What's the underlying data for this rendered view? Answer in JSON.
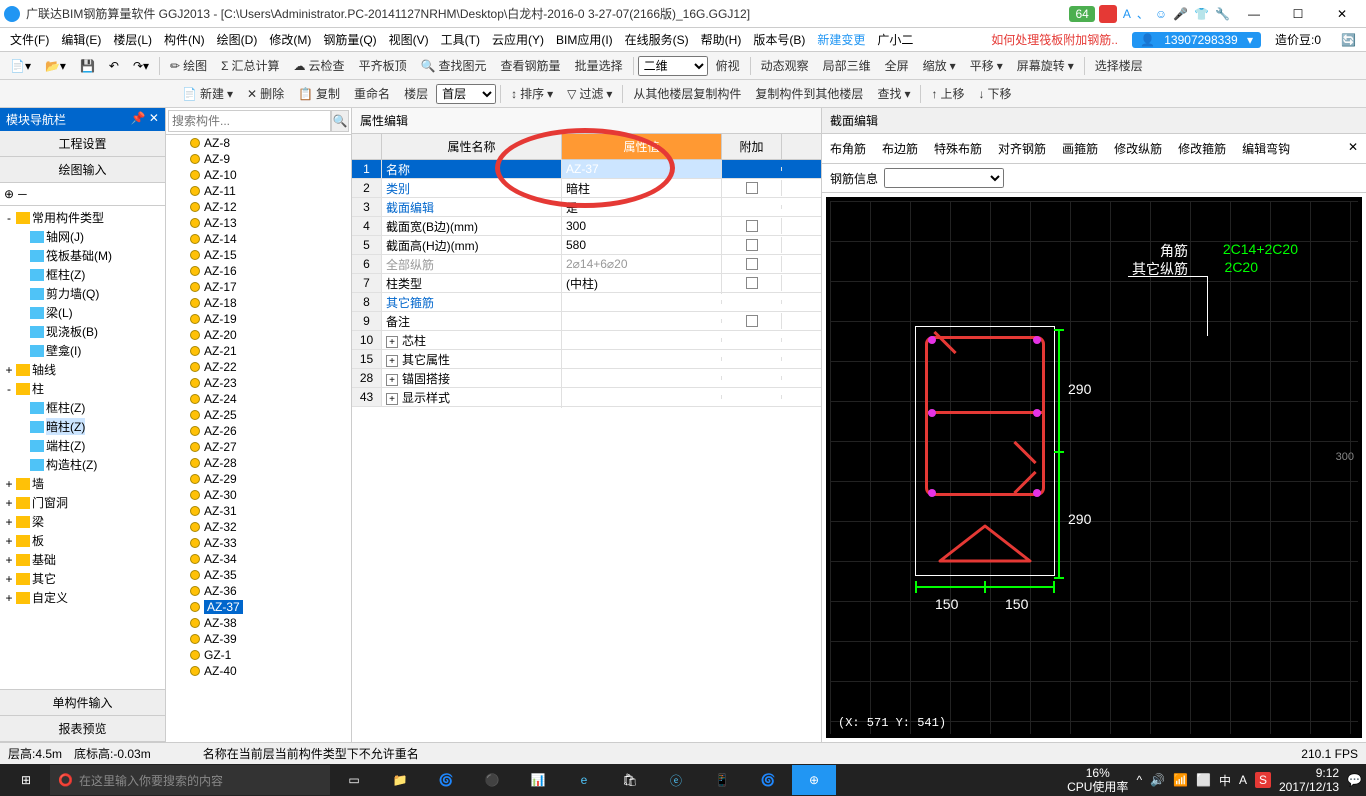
{
  "title": "广联达BIM钢筋算量软件 GGJ2013 - [C:\\Users\\Administrator.PC-20141127NRHM\\Desktop\\白龙村-2016-0     3-27-07(2166版)_16G.GGJ12]",
  "title_badge": "64",
  "menu": [
    "文件(F)",
    "编辑(E)",
    "楼层(L)",
    "构件(N)",
    "绘图(D)",
    "修改(M)",
    "钢筋量(Q)",
    "视图(V)",
    "工具(T)",
    "云应用(Y)",
    "BIM应用(I)",
    "在线服务(S)",
    "帮助(H)",
    "版本号(B)"
  ],
  "menu_new": "新建变更",
  "menu_user": "广小二",
  "menu_link": "如何处理筏板附加钢筋..",
  "phone": "13907298339",
  "cost_label": "造价豆:0",
  "toolbar1": [
    "绘图",
    "汇总计算",
    "云检查",
    "平齐板顶",
    "查找图元",
    "查看钢筋量",
    "批量选择"
  ],
  "toolbar1b": [
    "二维",
    "俯视",
    "动态观察",
    "局部三维",
    "全屏",
    "缩放",
    "平移",
    "屏幕旋转",
    "选择楼层"
  ],
  "toolbar2": [
    "新建",
    "删除",
    "复制",
    "重命名",
    "楼层",
    "首层"
  ],
  "toolbar2b": [
    "排序",
    "过滤",
    "从其他楼层复制构件",
    "复制构件到其他楼层",
    "查找",
    "上移",
    "下移"
  ],
  "nav": {
    "title": "模块导航栏",
    "sections": [
      "工程设置",
      "绘图输入"
    ],
    "tree": [
      {
        "lvl": 0,
        "exp": "-",
        "type": "fld",
        "label": "常用构件类型"
      },
      {
        "lvl": 1,
        "type": "ico",
        "label": "轴网(J)"
      },
      {
        "lvl": 1,
        "type": "ico",
        "label": "筏板基础(M)"
      },
      {
        "lvl": 1,
        "type": "ico",
        "label": "框柱(Z)"
      },
      {
        "lvl": 1,
        "type": "ico",
        "label": "剪力墙(Q)"
      },
      {
        "lvl": 1,
        "type": "ico",
        "label": "梁(L)"
      },
      {
        "lvl": 1,
        "type": "ico",
        "label": "现浇板(B)"
      },
      {
        "lvl": 1,
        "type": "ico",
        "label": "壁龛(I)"
      },
      {
        "lvl": 0,
        "exp": "+",
        "type": "fld",
        "label": "轴线"
      },
      {
        "lvl": 0,
        "exp": "-",
        "type": "fld",
        "label": "柱"
      },
      {
        "lvl": 1,
        "type": "ico",
        "label": "框柱(Z)"
      },
      {
        "lvl": 1,
        "type": "ico",
        "label": "暗柱(Z)",
        "sel": true
      },
      {
        "lvl": 1,
        "type": "ico",
        "label": "端柱(Z)"
      },
      {
        "lvl": 1,
        "type": "ico",
        "label": "构造柱(Z)"
      },
      {
        "lvl": 0,
        "exp": "+",
        "type": "fld",
        "label": "墙"
      },
      {
        "lvl": 0,
        "exp": "+",
        "type": "fld",
        "label": "门窗洞"
      },
      {
        "lvl": 0,
        "exp": "+",
        "type": "fld",
        "label": "梁"
      },
      {
        "lvl": 0,
        "exp": "+",
        "type": "fld",
        "label": "板"
      },
      {
        "lvl": 0,
        "exp": "+",
        "type": "fld",
        "label": "基础"
      },
      {
        "lvl": 0,
        "exp": "+",
        "type": "fld",
        "label": "其它"
      },
      {
        "lvl": 0,
        "exp": "+",
        "type": "fld",
        "label": "自定义"
      }
    ],
    "bottom": [
      "单构件输入",
      "报表预览"
    ]
  },
  "comp": {
    "toolbar": "",
    "search_placeholder": "搜索构件...",
    "items": [
      "AZ-8",
      "AZ-9",
      "AZ-10",
      "AZ-11",
      "AZ-12",
      "AZ-13",
      "AZ-14",
      "AZ-15",
      "AZ-16",
      "AZ-17",
      "AZ-18",
      "AZ-19",
      "AZ-20",
      "AZ-21",
      "AZ-22",
      "AZ-23",
      "AZ-24",
      "AZ-25",
      "AZ-26",
      "AZ-27",
      "AZ-28",
      "AZ-29",
      "AZ-30",
      "AZ-31",
      "AZ-32",
      "AZ-33",
      "AZ-34",
      "AZ-35",
      "AZ-36",
      "AZ-37",
      "AZ-38",
      "AZ-39",
      "GZ-1",
      "AZ-40"
    ],
    "selected": "AZ-37"
  },
  "prop": {
    "title": "属性编辑",
    "headers": [
      "",
      "属性名称",
      "属性值",
      "附加"
    ],
    "rows": [
      {
        "n": "1",
        "name": "名称",
        "val": "AZ-37",
        "sel": true
      },
      {
        "n": "2",
        "name": "类别",
        "val": "暗柱",
        "chk": true,
        "blue": true
      },
      {
        "n": "3",
        "name": "截面编辑",
        "val": "是",
        "blue": true
      },
      {
        "n": "4",
        "name": "截面宽(B边)(mm)",
        "val": "300",
        "chk": true
      },
      {
        "n": "5",
        "name": "截面高(H边)(mm)",
        "val": "580",
        "chk": true
      },
      {
        "n": "6",
        "name": "全部纵筋",
        "val": "2⌀14+6⌀20",
        "chk": true,
        "gray": true
      },
      {
        "n": "7",
        "name": "柱类型",
        "val": "(中柱)",
        "chk": true
      },
      {
        "n": "8",
        "name": "其它箍筋",
        "val": "",
        "blue": true
      },
      {
        "n": "9",
        "name": "备注",
        "val": "",
        "chk": true
      },
      {
        "n": "10",
        "name": "芯柱",
        "exp": "+"
      },
      {
        "n": "15",
        "name": "其它属性",
        "exp": "+"
      },
      {
        "n": "28",
        "name": "锚固搭接",
        "exp": "+"
      },
      {
        "n": "43",
        "name": "显示样式",
        "exp": "+"
      }
    ]
  },
  "section": {
    "title": "截面编辑",
    "tabs": [
      "布角筋",
      "布边筋",
      "特殊布筋",
      "对齐钢筋",
      "画箍筋",
      "修改纵筋",
      "修改箍筋",
      "编辑弯钩"
    ],
    "info_label": "钢筋信息",
    "coord": "(X: 571 Y: 541)",
    "annot1": "角筋",
    "annot1v": "2C14+2C20",
    "annot2": "其它纵筋",
    "annot2v": "2C20",
    "dim_v": "290",
    "dim_h": "150",
    "ruler": "300"
  },
  "status": {
    "floor": "层高:4.5m",
    "bottom": "底标高:-0.03m",
    "msg": "名称在当前层当前构件类型下不允许重名",
    "fps": "210.1 FPS"
  },
  "taskbar": {
    "search": "在这里输入你要搜索的内容",
    "cpu": "16%",
    "cpu2": "CPU使用率",
    "time": "9:12",
    "date": "2017/12/13"
  }
}
